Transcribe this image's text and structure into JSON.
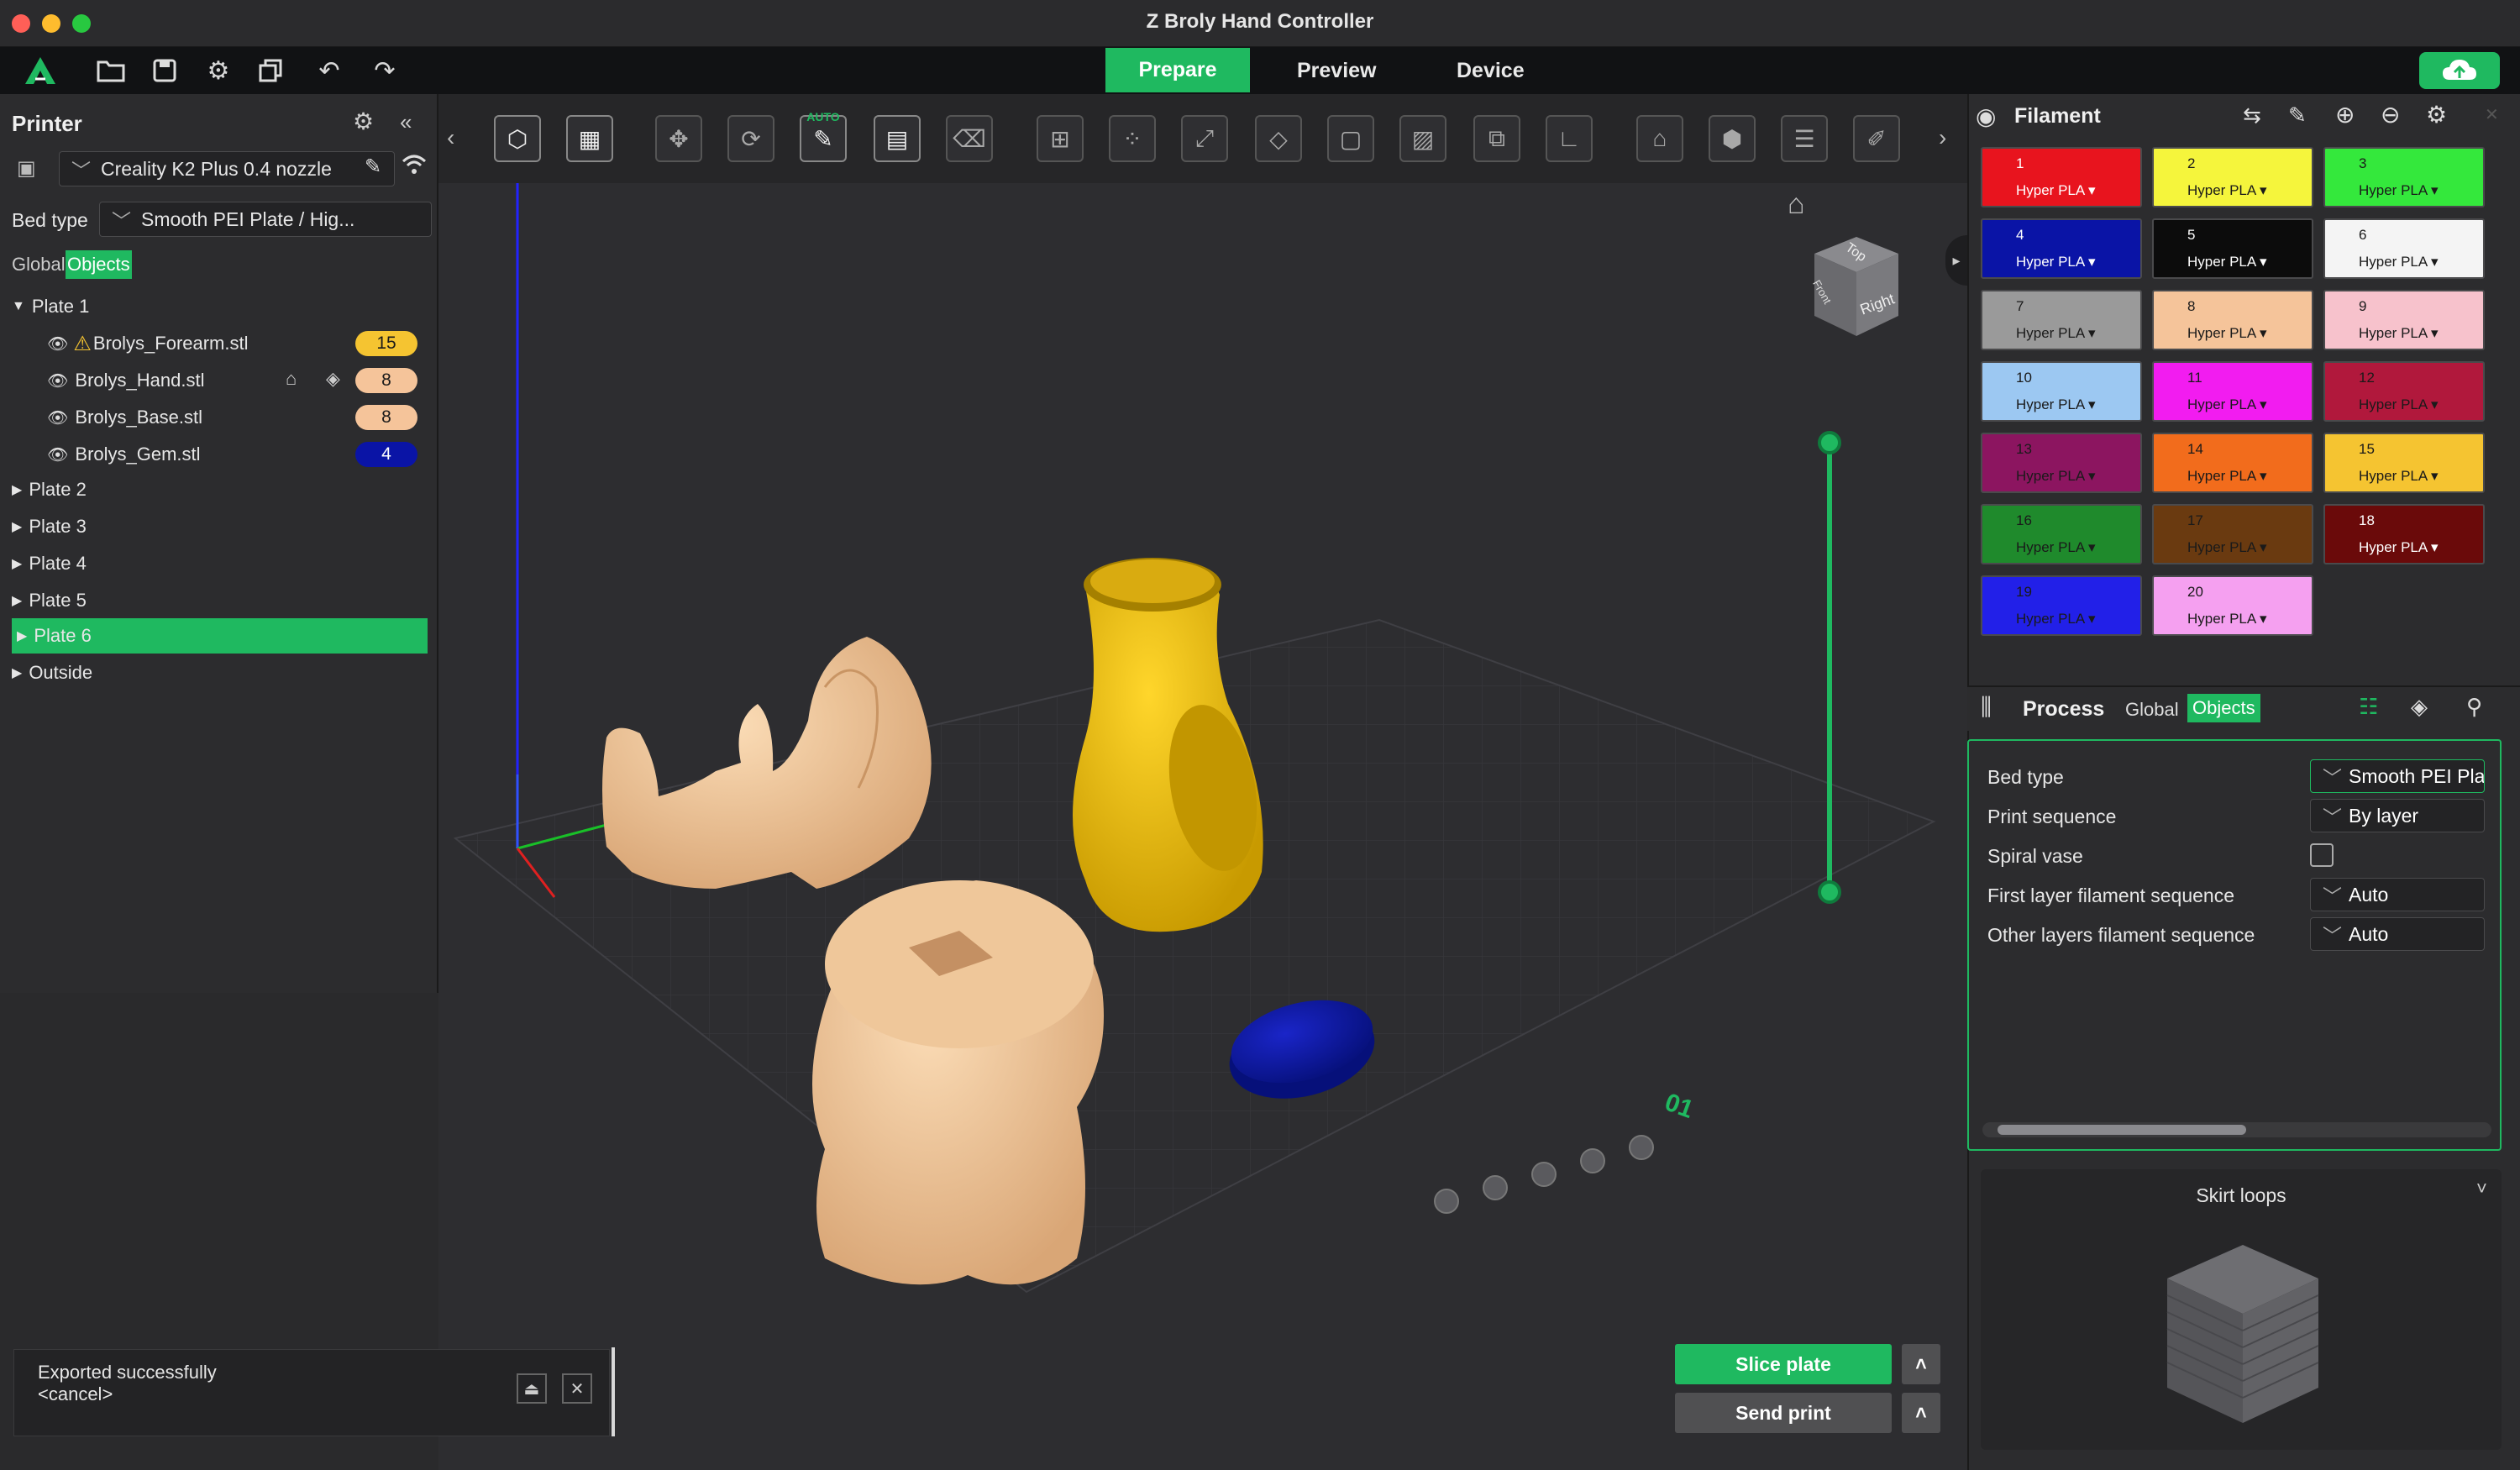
{
  "window": {
    "title": "Z Broly Hand Controller"
  },
  "nav": {
    "tabs": [
      "Prepare",
      "Preview",
      "Device"
    ],
    "active": "Prepare"
  },
  "printer_panel": {
    "title": "Printer",
    "printer_name": "Creality K2 Plus 0.4 nozzle",
    "bed_type_label": "Bed type",
    "bed_type_value": "Smooth PEI Plate / Hig...",
    "tabs": [
      "Global",
      "Objects"
    ],
    "plates": [
      {
        "label": "Plate 1",
        "expanded": true
      },
      {
        "label": "Plate 2"
      },
      {
        "label": "Plate 3"
      },
      {
        "label": "Plate 4"
      },
      {
        "label": "Plate 5"
      },
      {
        "label": "Plate 6",
        "selected": true
      },
      {
        "label": "Outside"
      }
    ],
    "objects": [
      {
        "name": "Brolys_Forearm.stl",
        "warning": true,
        "filament": "15",
        "color": "#f5c431",
        "text_color": "#1a1a1a"
      },
      {
        "name": "Brolys_Hand.stl",
        "filament": "8",
        "color": "#f5c49a",
        "text_color": "#1a1a1a"
      },
      {
        "name": "Brolys_Base.stl",
        "filament": "8",
        "color": "#f5c49a",
        "text_color": "#1a1a1a"
      },
      {
        "name": "Brolys_Gem.stl",
        "filament": "4",
        "color": "#0a14a6",
        "text_color": "#ffffff"
      }
    ]
  },
  "notification": {
    "line1": "Exported successfully",
    "line2": "<cancel>"
  },
  "filament_panel": {
    "title": "Filament",
    "filaments": [
      {
        "num": "1",
        "name": "Hyper PLA",
        "color": "#e8141e",
        "text": "#ffffff"
      },
      {
        "num": "2",
        "name": "Hyper PLA",
        "color": "#f5f53c",
        "text": "#1a1a1a"
      },
      {
        "num": "3",
        "name": "Hyper PLA",
        "color": "#34e83c",
        "text": "#1a1a1a"
      },
      {
        "num": "4",
        "name": "Hyper PLA",
        "color": "#0a14a6",
        "text": "#ffffff"
      },
      {
        "num": "5",
        "name": "Hyper PLA",
        "color": "#0c0c0c",
        "text": "#ffffff"
      },
      {
        "num": "6",
        "name": "Hyper PLA",
        "color": "#f4f4f4",
        "text": "#1a1a1a"
      },
      {
        "num": "7",
        "name": "Hyper PLA",
        "color": "#9a9a9a",
        "text": "#1a1a1a"
      },
      {
        "num": "8",
        "name": "Hyper PLA",
        "color": "#f5c49a",
        "text": "#1a1a1a"
      },
      {
        "num": "9",
        "name": "Hyper PLA",
        "color": "#f7c2cc",
        "text": "#1a1a1a"
      },
      {
        "num": "10",
        "name": "Hyper PLA",
        "color": "#9cc8f2",
        "text": "#1a1a1a"
      },
      {
        "num": "11",
        "name": "Hyper PLA",
        "color": "#f21cf0",
        "text": "#1a1a1a"
      },
      {
        "num": "12",
        "name": "Hyper PLA",
        "color": "#b1183c",
        "text": "#1a1a1a"
      },
      {
        "num": "13",
        "name": "Hyper PLA",
        "color": "#8c1560",
        "text": "#1a1a1a"
      },
      {
        "num": "14",
        "name": "Hyper PLA",
        "color": "#f26c1c",
        "text": "#1a1a1a"
      },
      {
        "num": "15",
        "name": "Hyper PLA",
        "color": "#f5c431",
        "text": "#1a1a1a"
      },
      {
        "num": "16",
        "name": "Hyper PLA",
        "color": "#1f8a2c",
        "text": "#1a1a1a"
      },
      {
        "num": "17",
        "name": "Hyper PLA",
        "color": "#6a3a10",
        "text": "#1a1a1a"
      },
      {
        "num": "18",
        "name": "Hyper PLA",
        "color": "#6a0a0a",
        "text": "#ffffff"
      },
      {
        "num": "19",
        "name": "Hyper PLA",
        "color": "#2220e8",
        "text": "#1a1a1a"
      },
      {
        "num": "20",
        "name": "Hyper PLA",
        "color": "#f5a0f0",
        "text": "#1a1a1a"
      }
    ]
  },
  "process_panel": {
    "title": "Process",
    "tabs": [
      "Global",
      "Objects"
    ],
    "rows": [
      {
        "label": "Bed type",
        "value": "Smooth PEI Pla...",
        "type": "select"
      },
      {
        "label": "Print sequence",
        "value": "By layer",
        "type": "select"
      },
      {
        "label": "Spiral vase",
        "type": "checkbox"
      },
      {
        "label": "First layer filament sequence",
        "value": "Auto",
        "type": "select"
      },
      {
        "label": "Other layers filament sequence",
        "value": "Auto",
        "type": "select"
      }
    ],
    "preview_title": "Skirt loops"
  },
  "actions": {
    "slice": "Slice plate",
    "send": "Send print"
  },
  "view_cube": {
    "top": "Top",
    "front": "Front",
    "right": "Right"
  },
  "toolbar": {
    "auto_label": "AUTO"
  },
  "plate_label": "01"
}
